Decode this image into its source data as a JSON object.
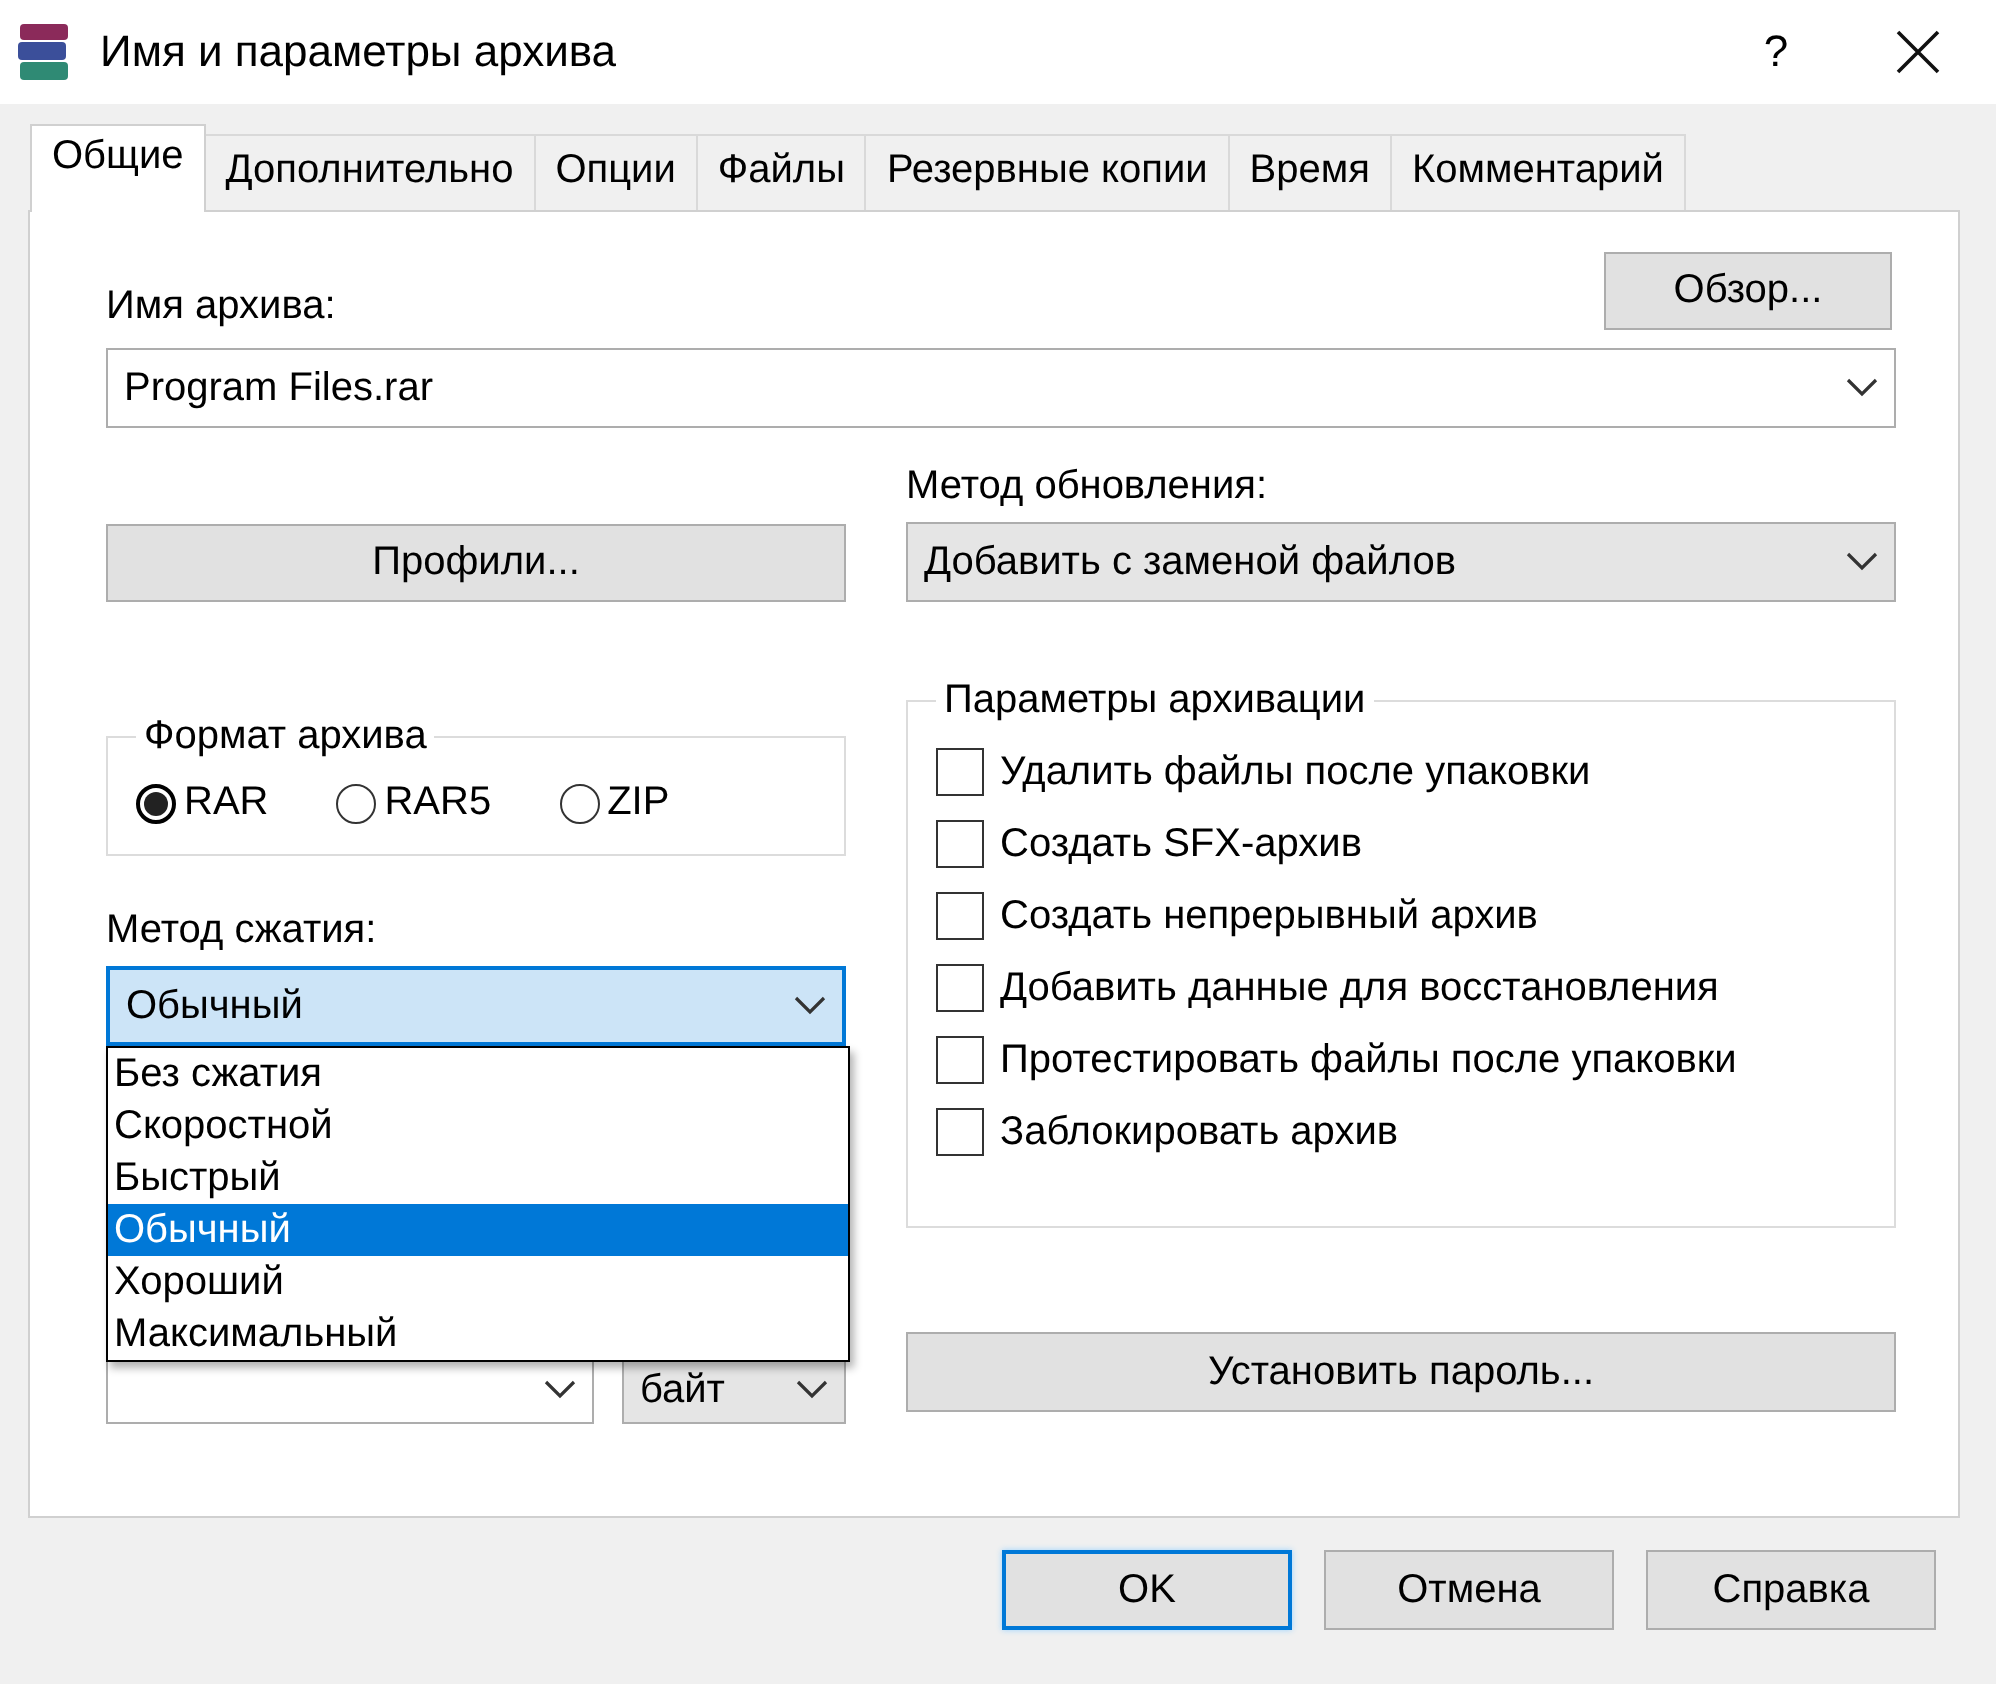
{
  "window": {
    "title": "Имя и параметры архива",
    "help": "?"
  },
  "tabs": [
    {
      "label": "Общие",
      "selected": true
    },
    {
      "label": "Дополнительно",
      "selected": false
    },
    {
      "label": "Опции",
      "selected": false
    },
    {
      "label": "Файлы",
      "selected": false
    },
    {
      "label": "Резервные копии",
      "selected": false
    },
    {
      "label": "Время",
      "selected": false
    },
    {
      "label": "Комментарий",
      "selected": false
    }
  ],
  "archive_name": {
    "label": "Имя архива:",
    "value": "Program Files.rar"
  },
  "browse_button": "Обзор...",
  "profiles_button": "Профили...",
  "update_method": {
    "label": "Метод обновления:",
    "value": "Добавить с заменой файлов"
  },
  "archive_format": {
    "title": "Формат архива",
    "options": [
      {
        "label": "RAR",
        "selected": true
      },
      {
        "label": "RAR5",
        "selected": false
      },
      {
        "label": "ZIP",
        "selected": false
      }
    ]
  },
  "compression_method": {
    "label": "Метод сжатия:",
    "value": "Обычный",
    "expanded": true,
    "options": [
      {
        "label": "Без сжатия",
        "selected": false
      },
      {
        "label": "Скоростной",
        "selected": false
      },
      {
        "label": "Быстрый",
        "selected": false
      },
      {
        "label": "Обычный",
        "selected": true
      },
      {
        "label": "Хороший",
        "selected": false
      },
      {
        "label": "Максимальный",
        "selected": false
      }
    ]
  },
  "dictionary": {
    "unit": "байт"
  },
  "archiving_options": {
    "title": "Параметры архивации",
    "items": [
      {
        "label": "Удалить файлы после упаковки",
        "checked": false
      },
      {
        "label": "Создать SFX-архив",
        "checked": false
      },
      {
        "label": "Создать непрерывный архив",
        "checked": false
      },
      {
        "label": "Добавить данные для восстановления",
        "checked": false
      },
      {
        "label": "Протестировать файлы после упаковки",
        "checked": false
      },
      {
        "label": "Заблокировать архив",
        "checked": false
      }
    ]
  },
  "password_button": "Установить пароль...",
  "buttons": [
    {
      "label": "OK",
      "default": true
    },
    {
      "label": "Отмена",
      "default": false
    },
    {
      "label": "Справка",
      "default": false
    }
  ]
}
